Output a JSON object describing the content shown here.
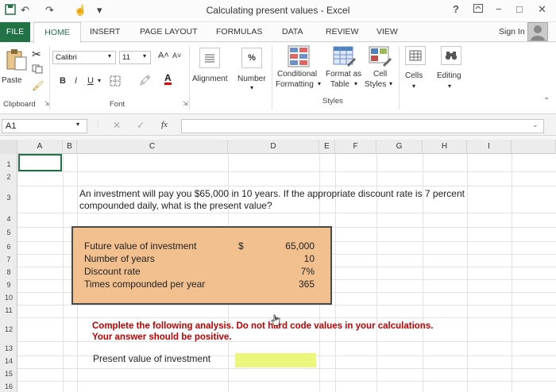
{
  "window": {
    "title": "Calculating present values - Excel",
    "help": "?",
    "controls": [
      "−",
      "□",
      "✕"
    ]
  },
  "tabs": [
    "FILE",
    "HOME",
    "INSERT",
    "PAGE LAYOUT",
    "FORMULAS",
    "DATA",
    "REVIEW",
    "VIEW"
  ],
  "account": {
    "sign_in": "Sign In"
  },
  "ribbon": {
    "paste": "Paste",
    "clipboard": "Clipboard",
    "font_name": "Calibri",
    "font_size": "11",
    "grow_font": "A˄",
    "shrink_font": "A˅",
    "bold": "B",
    "italic": "I",
    "underline": "U",
    "font_group": "Font",
    "alignment": "Alignment",
    "number": "Number",
    "percent": "%",
    "conditional_1": "Conditional",
    "conditional_2": "Formatting",
    "format_table_1": "Format as",
    "format_table_2": "Table",
    "cell_styles_1": "Cell",
    "cell_styles_2": "Styles",
    "styles_group": "Styles",
    "cells": "Cells",
    "editing": "Editing"
  },
  "formula_bar": {
    "name_box": "A1",
    "fx": "fx",
    "cancel": "✕",
    "enter": "✓",
    "formula": ""
  },
  "columns": [
    "A",
    "B",
    "C",
    "D",
    "E",
    "F",
    "G",
    "H",
    "I"
  ],
  "rows": [
    "1",
    "2",
    "3",
    "4",
    "5",
    "6",
    "7",
    "8",
    "9",
    "10",
    "11",
    "12",
    "13",
    "14",
    "15",
    "16"
  ],
  "sheet": {
    "intro": "An investment will pay you $65,000 in 10 years. If the appropriate discount rate is 7 percent compounded daily, what is the present value?",
    "inputs": [
      {
        "label": "Future value of investment",
        "currency": "$",
        "value": "65,000"
      },
      {
        "label": "Number of years",
        "currency": "",
        "value": "10"
      },
      {
        "label": "Discount rate",
        "currency": "",
        "value": "7%"
      },
      {
        "label": "Times compounded per year",
        "currency": "",
        "value": "365"
      }
    ],
    "instruction_1": "Complete the following analysis. Do not hard code values in your calculations.",
    "instruction_2": "Your answer should be positive.",
    "pv_label": "Present value of investment",
    "pv_value": ""
  },
  "colors": {
    "excel_green": "#217346",
    "input_box": "#f2c08f",
    "answer_cell": "#eaf77a",
    "instruction_red": "#c00000"
  }
}
